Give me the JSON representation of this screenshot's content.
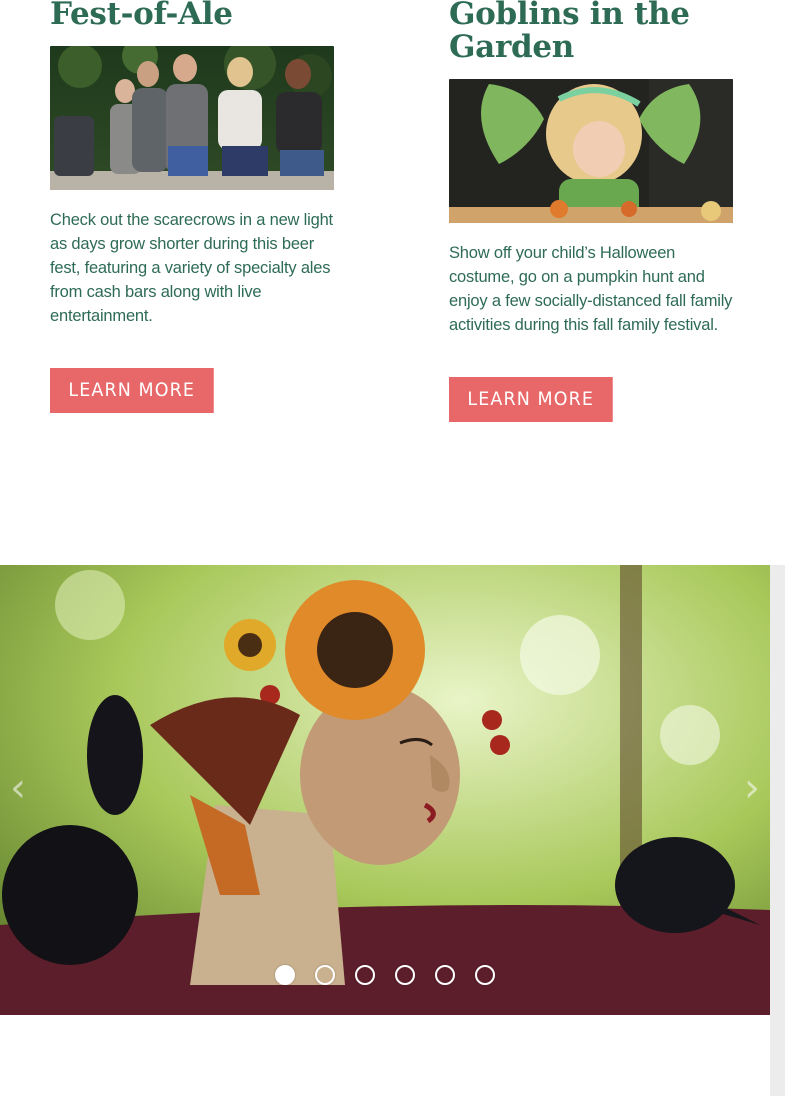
{
  "cards": [
    {
      "title": "Fest-of-Ale",
      "description": "Check out the scarecrows in a new light as days grow shorter during this beer fest, featuring a variety of specialty ales from cash bars along with live entertainment.",
      "button_label": "LEARN MORE"
    },
    {
      "title": "Goblins in the Garden",
      "description": "Show off your child’s Halloween costume, go on a pumpkin hunt and enjoy a few socially-distanced fall family activities during this fall family festival.",
      "button_label": "LEARN MORE"
    }
  ],
  "slider": {
    "slide_count": 6,
    "active_index": 0,
    "prev_icon": "chevron-left-icon",
    "next_icon": "chevron-right-icon"
  },
  "colors": {
    "heading": "#2e6b55",
    "button": "#e8686a",
    "body_text": "#2e6b55"
  }
}
